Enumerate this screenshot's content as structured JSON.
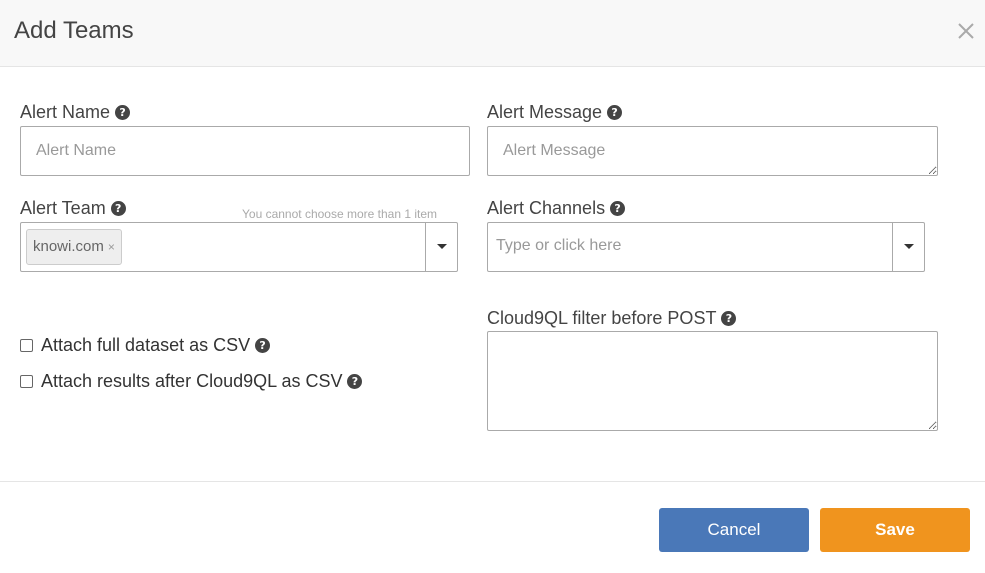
{
  "header": {
    "title": "Add Teams",
    "close_icon": "close-icon"
  },
  "form": {
    "alert_name": {
      "label": "Alert Name",
      "placeholder": "Alert Name",
      "value": ""
    },
    "alert_message": {
      "label": "Alert Message",
      "placeholder": "Alert Message",
      "value": ""
    },
    "alert_team": {
      "label": "Alert Team",
      "limit_note": "You cannot choose more than 1 item",
      "selected": [
        {
          "label": "knowi.com",
          "remove": "×"
        }
      ]
    },
    "alert_channels": {
      "label": "Alert Channels",
      "placeholder": "Type or click here"
    },
    "attach_full": {
      "label": "Attach full dataset as CSV",
      "checked": false
    },
    "attach_results": {
      "label": "Attach results after Cloud9QL as CSV",
      "checked": false
    },
    "cloud9ql_filter": {
      "label": "Cloud9QL filter before POST",
      "value": ""
    },
    "help_glyph": "?"
  },
  "footer": {
    "cancel_label": "Cancel",
    "save_label": "Save"
  },
  "colors": {
    "cancel": "#4a78b8",
    "save": "#f0941e"
  }
}
